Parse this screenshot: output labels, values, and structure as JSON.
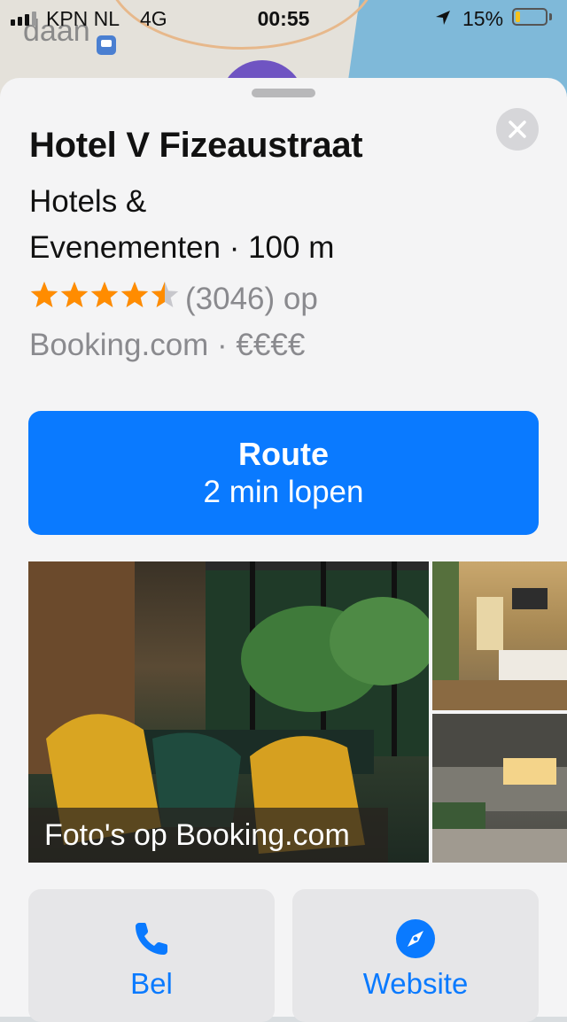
{
  "status_bar": {
    "carrier": "KPN NL",
    "network": "4G",
    "time": "00:55",
    "battery_percent": "15%",
    "battery_level": 0.15,
    "signal_bars": 4,
    "signal_bars_filled": 3
  },
  "map": {
    "label": "daan"
  },
  "place": {
    "name": "Hotel V Fizeaustraat",
    "category_line1": "Hotels &",
    "category_line2": "Evenementen · 100 m",
    "rating_stars": 4.5,
    "rating_text": "(3046) op",
    "rating_source_line": "Booking.com · €€€€",
    "star_color": "#ff8c00"
  },
  "route_button": {
    "label": "Route",
    "time": "2 min lopen",
    "color": "#0a7aff"
  },
  "photos": {
    "caption": "Foto's op Booking.com"
  },
  "actions": {
    "call_label": "Bel",
    "call_icon": "phone-icon",
    "website_label": "Website",
    "website_icon": "compass-icon"
  }
}
